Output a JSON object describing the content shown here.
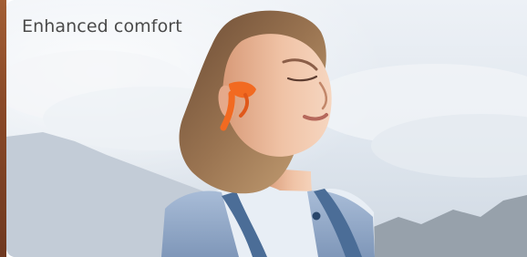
{
  "banner": {
    "headline": "Enhanced comfort",
    "image_subject": "woman-wearing-open-ear-headphones-outdoors"
  },
  "colors": {
    "headline": "#4a4a4a",
    "headphone_accent": "#f26a21",
    "sky": "#dfe6ee",
    "vest": "#8ea6c6"
  }
}
